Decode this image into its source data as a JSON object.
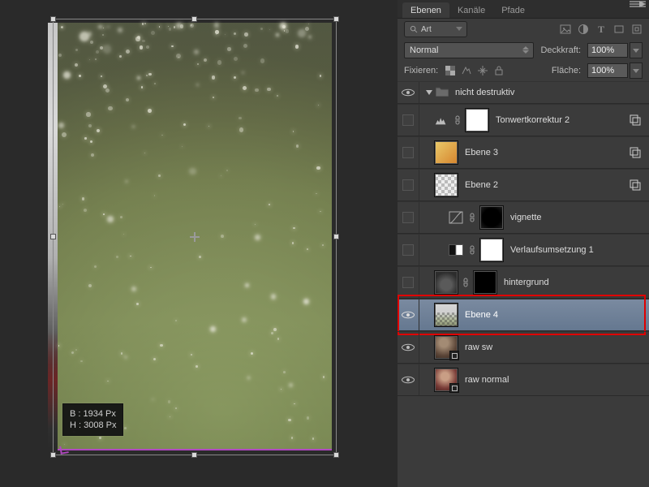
{
  "canvas": {
    "dims": {
      "w": "B : 1934 Px",
      "h": "H : 3008 Px"
    }
  },
  "panel": {
    "tabs": {
      "layers": "Ebenen",
      "channels": "Kanäle",
      "paths": "Pfade"
    },
    "filter_label": "Art",
    "blend": {
      "mode": "Normal",
      "opacity_label": "Deckkraft:",
      "opacity": "100%",
      "fill_label": "Fläche:",
      "fill": "100%"
    },
    "lock_label": "Fixieren:"
  },
  "layers": {
    "group": "nicht destruktiv",
    "items": [
      {
        "name": "Tonwertkorrektur 2"
      },
      {
        "name": "Ebene 3"
      },
      {
        "name": "Ebene 2"
      },
      {
        "name": "vignette"
      },
      {
        "name": "Verlaufsumsetzung 1"
      },
      {
        "name": "hintergrund"
      },
      {
        "name": "Ebene 4"
      },
      {
        "name": "raw sw"
      },
      {
        "name": "raw normal"
      }
    ]
  }
}
